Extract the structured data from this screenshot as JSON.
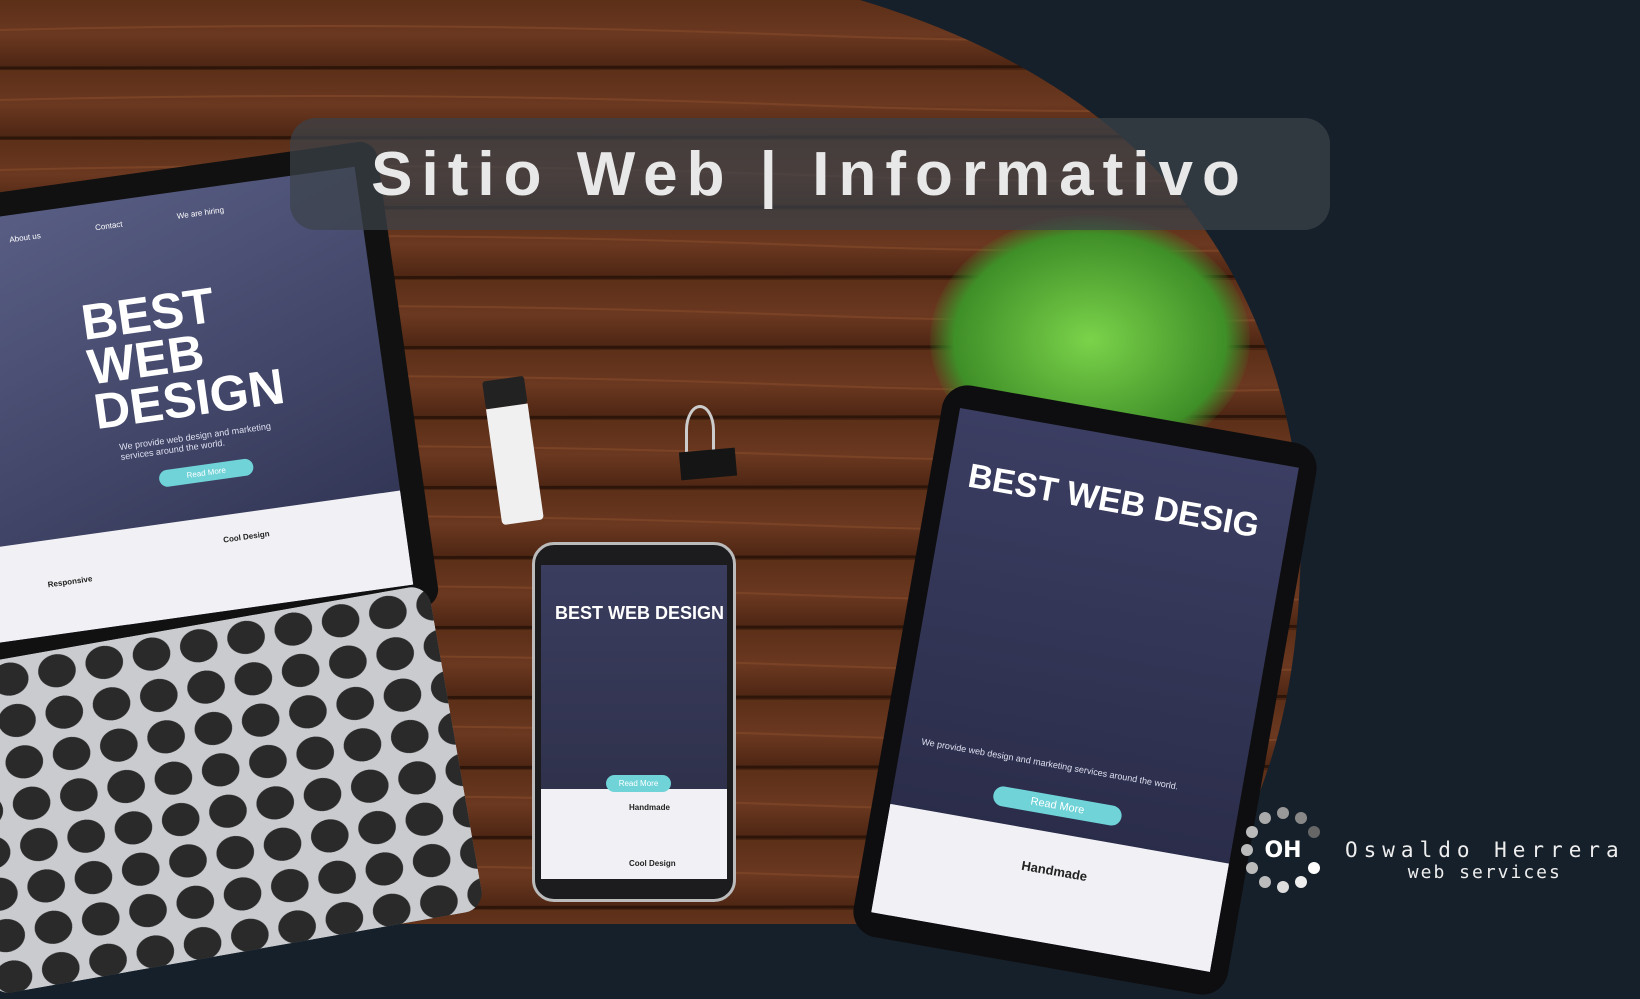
{
  "title": "Sitio Web | Informativo",
  "laptop": {
    "nav": [
      "About us",
      "Contact",
      "We are hiring"
    ],
    "headline": "BEST WEB DESIGN",
    "subtitle": "We provide web design and marketing services around the world.",
    "button": "Read More",
    "cards": [
      "Responsive",
      "Cool Design"
    ]
  },
  "phone": {
    "headline": "BEST WEB DESIGN",
    "button": "Read More",
    "cards": [
      "Handmade",
      "Cool Design"
    ]
  },
  "tablet": {
    "headline": "BEST WEB DESIG",
    "subtitle": "We provide web design and marketing services around the world.",
    "button": "Read More",
    "cards": [
      "Handmade"
    ]
  },
  "logo": {
    "mark": "OH",
    "name": "Oswaldo Herrera",
    "tagline": "web services"
  },
  "colors": {
    "background": "#16202a",
    "wood": "#5a2d17",
    "accent": "#6fd3d8"
  }
}
